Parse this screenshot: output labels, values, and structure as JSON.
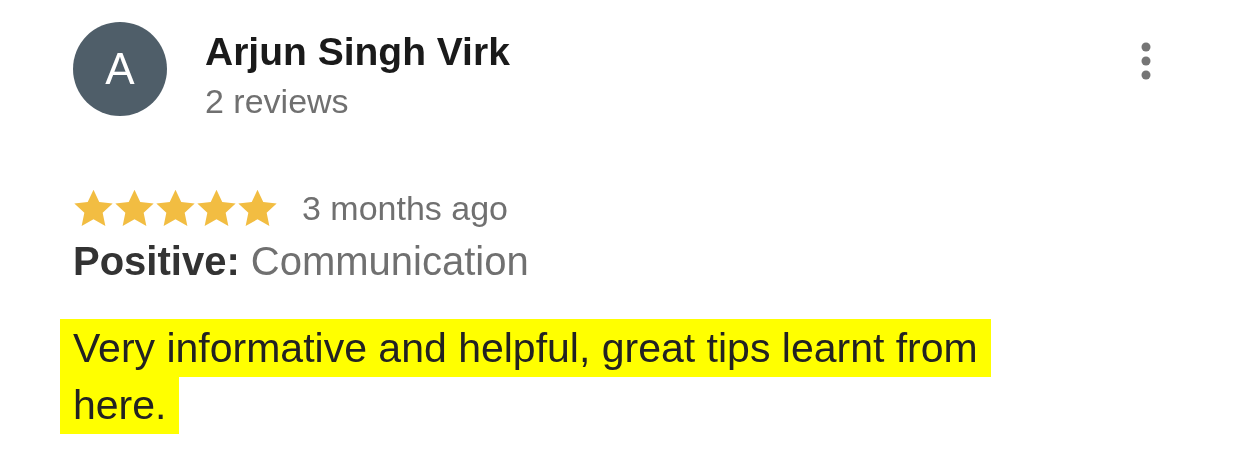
{
  "review": {
    "avatar_letter": "A",
    "author": "Arjun Singh Virk",
    "author_meta": "2 reviews",
    "stars": 5,
    "time": "3 months ago",
    "attributes": "**Positive:** Communication",
    "text": "Very informative and helpful, great tips learnt from here.",
    "highlighted": true
  }
}
